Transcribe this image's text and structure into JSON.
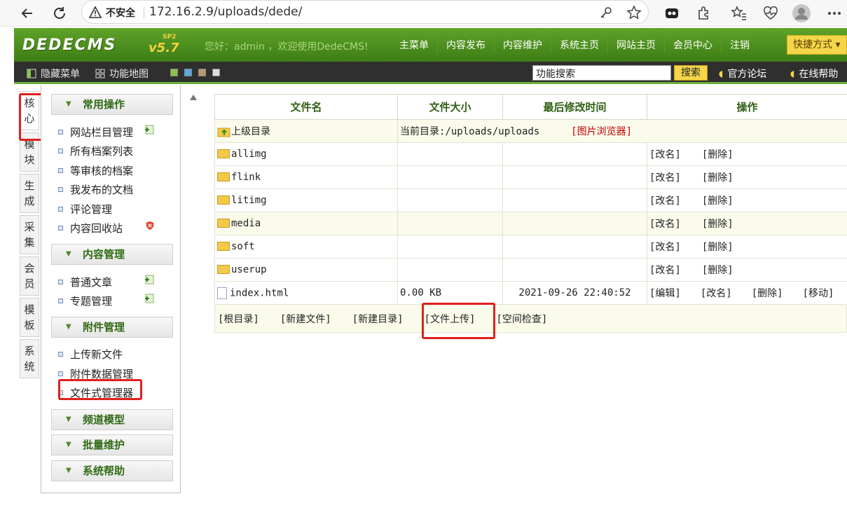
{
  "browser": {
    "insecure_label": "不安全",
    "url": "172.16.2.9/uploads/dede/"
  },
  "header": {
    "logo": "DEDECMS",
    "version": "v5.7",
    "version_tag": "SP2",
    "welcome": "您好：admin ，欢迎使用DedeCMS!",
    "nav": [
      "主菜单",
      "内容发布",
      "内容维护",
      "系统主页",
      "网站主页",
      "会员中心",
      "注销"
    ],
    "quick": "快捷方式"
  },
  "toolbar": {
    "hide_menu": "隐藏菜单",
    "func_map": "功能地图",
    "search_value": "功能搜索",
    "search_btn": "搜索",
    "forum": "官方论坛",
    "help": "在线帮助"
  },
  "vtabs": [
    {
      "c1": "核",
      "c2": "心"
    },
    {
      "c1": "模",
      "c2": "块"
    },
    {
      "c1": "生",
      "c2": "成"
    },
    {
      "c1": "采",
      "c2": "集"
    },
    {
      "c1": "会",
      "c2": "员"
    },
    {
      "c1": "模",
      "c2": "板"
    },
    {
      "c1": "系",
      "c2": "统"
    }
  ],
  "menu": {
    "group1": "常用操作",
    "g1_items": [
      "网站栏目管理",
      "所有档案列表",
      "等审核的档案",
      "我发布的文档",
      "评论管理",
      "内容回收站"
    ],
    "group2": "内容管理",
    "g2_items": [
      "普通文章",
      "专题管理"
    ],
    "group3": "附件管理",
    "g3_items": [
      "上传新文件",
      "附件数据管理",
      "文件式管理器"
    ],
    "group4": "频道模型",
    "group5": "批量维护",
    "group6": "系统帮助"
  },
  "table": {
    "headers": [
      "文件名",
      "文件大小",
      "最后修改时间",
      "操作"
    ],
    "parent": {
      "name": "上级目录",
      "current": "当前目录:/uploads/uploads",
      "browser_link": "[图片浏览器]"
    },
    "folders": [
      "allimg",
      "flink",
      "litimg",
      "media",
      "soft",
      "userup"
    ],
    "folder_actions": [
      "[改名]",
      "[删除]"
    ],
    "file": {
      "name": "index.html",
      "size": "0.00 KB",
      "mtime": "2021-09-26 22:40:52",
      "actions": [
        "[编辑]",
        "[改名]",
        "[删除]",
        "[移动]"
      ]
    },
    "bottom": [
      "[根目录]",
      "[新建文件]",
      "[新建目录]",
      "[文件上传]",
      "[空间检查]"
    ]
  }
}
